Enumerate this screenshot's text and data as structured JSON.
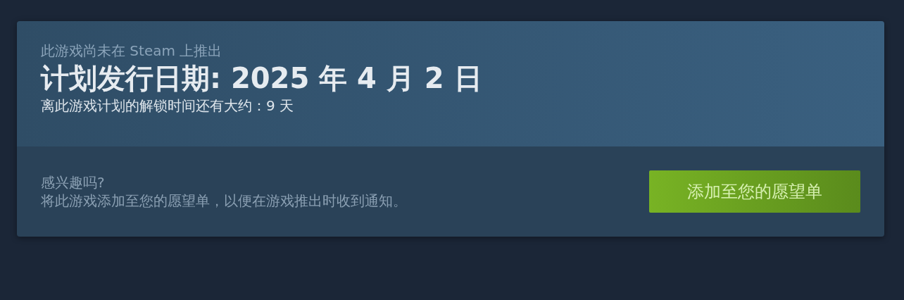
{
  "release": {
    "notice": "此游戏尚未在 Steam 上推出",
    "date_title": "计划发行日期: 2025 年 4 月 2 日",
    "countdown": "离此游戏计划的解锁时间还有大约：9 天"
  },
  "wishlist": {
    "question": "感兴趣吗?",
    "description": "将此游戏添加至您的愿望单，以便在游戏推出时收到通知。",
    "button": "添加至您的愿望单"
  }
}
